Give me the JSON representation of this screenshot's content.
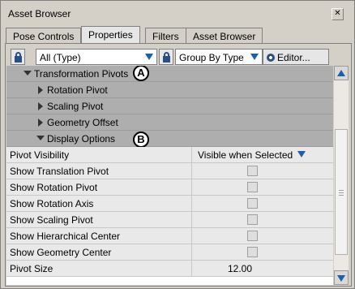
{
  "window": {
    "title": "Asset Browser",
    "close_glyph": "✕"
  },
  "tabs": [
    {
      "label": "Pose Controls",
      "active": false
    },
    {
      "label": "Properties",
      "active": true
    },
    {
      "label": "Filters",
      "active": false
    },
    {
      "label": "Asset Browser",
      "active": false
    }
  ],
  "toolbar": {
    "type_filter": "All (Type)",
    "group_by": "Group By Type",
    "editor_label": "Editor..."
  },
  "tree": {
    "transformation_pivots": "Transformation Pivots",
    "rotation_pivot": "Rotation Pivot",
    "scaling_pivot": "Scaling Pivot",
    "geometry_offset": "Geometry Offset",
    "display_options": "Display Options"
  },
  "properties": [
    {
      "label": "Pivot Visibility",
      "value": "Visible when Selected"
    },
    {
      "label": "Show Translation Pivot"
    },
    {
      "label": "Show Rotation Pivot"
    },
    {
      "label": "Show Rotation Axis"
    },
    {
      "label": "Show Scaling Pivot"
    },
    {
      "label": "Show Hierarchical Center"
    },
    {
      "label": "Show Geometry Center"
    },
    {
      "label": "Pivot Size",
      "value": "12.00"
    }
  ],
  "callouts": {
    "a": "A",
    "b": "B"
  },
  "colors": {
    "accent": "#1f5fa6",
    "group_row": "#aeaeae",
    "prop_row": "#e9e9e9"
  },
  "icons": [
    "lock-icon",
    "dropdown-arrow-icon",
    "gear-icon",
    "expand-arrow-icon",
    "collapse-arrow-icon",
    "scroll-up-icon",
    "scroll-down-icon",
    "close-icon"
  ]
}
